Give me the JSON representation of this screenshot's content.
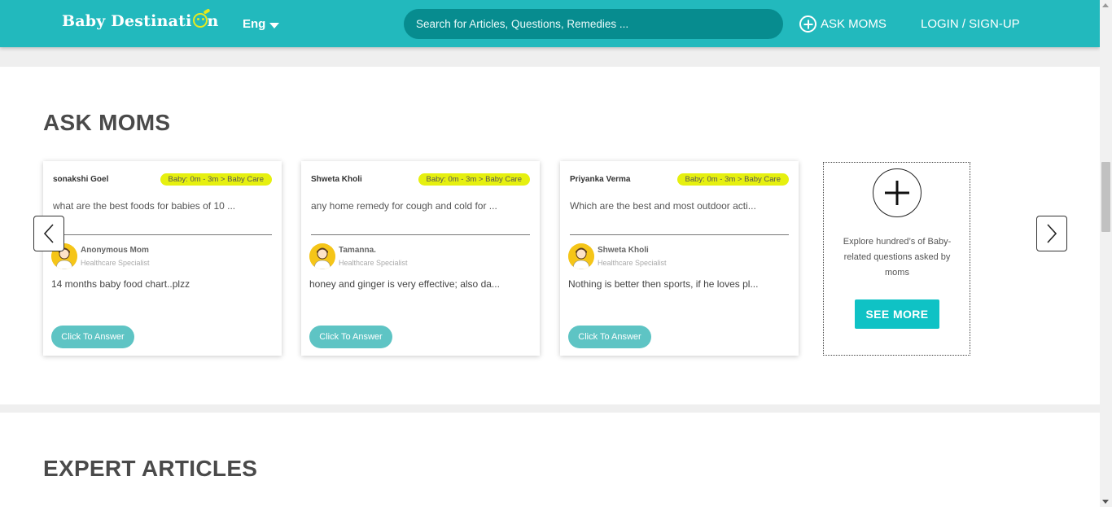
{
  "header": {
    "logo": "Baby Destinati",
    "logo_tail": "n",
    "language": "Eng",
    "search_placeholder": "Search for Articles, Questions, Remedies ...",
    "ask_moms": "ASK MOMS",
    "login": "LOGIN / SIGN-UP"
  },
  "ask_moms": {
    "title": "ASK MOMS",
    "cards": [
      {
        "user": "sonakshi Goel",
        "badge": "Baby: 0m - 3m > Baby Care",
        "question": "what are the best foods for babies of 10 ...",
        "answerer": "Anonymous Mom",
        "role": "Healthcare Specialist",
        "answer": "14 months baby food chart..plzz",
        "button": "Click To Answer"
      },
      {
        "user": "Shweta Kholi",
        "badge": "Baby: 0m - 3m > Baby Care",
        "question": "any home remedy for cough and cold for ...",
        "answerer": "Tamanna.",
        "role": "Healthcare Specialist",
        "answer": "honey and ginger is very effective; also da...",
        "button": "Click To Answer"
      },
      {
        "user": "Priyanka Verma",
        "badge": "Baby: 0m - 3m > Baby Care",
        "question": "Which are the best and most outdoor acti...",
        "answerer": "Shweta Kholi",
        "role": "Healthcare Specialist",
        "answer": "Nothing is better then sports, if he loves pl...",
        "button": "Click To Answer"
      }
    ],
    "see_more": {
      "text": "Explore hundred’s of Baby-related questions asked by moms",
      "button": "SEE MORE"
    }
  },
  "expert_articles": {
    "title": "EXPERT ARTICLES"
  },
  "colors": {
    "brand": "#22b9bd",
    "search_bg": "#078c8f",
    "badge": "#e6f00f",
    "answer_button": "#5ec4c4",
    "see_more_button": "#0fc2c5"
  },
  "icons": {
    "prev": "chevron-left-icon",
    "next": "chevron-right-icon",
    "add": "plus-icon",
    "language": "caret-down-icon"
  }
}
